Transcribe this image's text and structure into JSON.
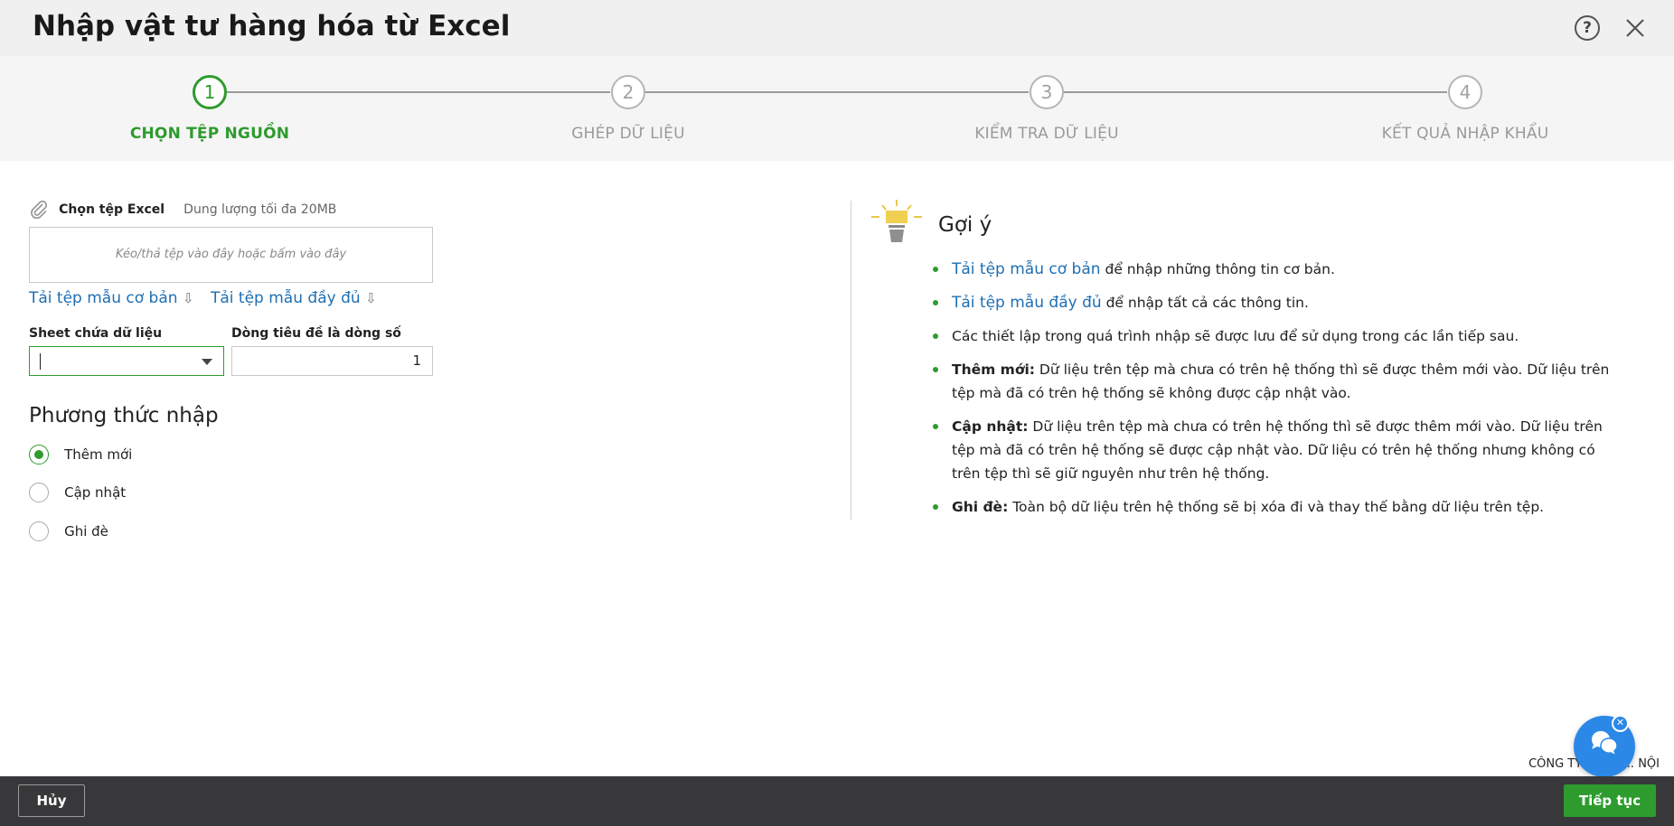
{
  "header": {
    "title": "Nhập vật tư hàng hóa từ Excel",
    "help_label": "?",
    "help_icon": "question-circle-icon",
    "close_icon": "close-icon"
  },
  "steps": [
    {
      "number": "1",
      "label": "CHỌN TỆP NGUỒN",
      "active": true
    },
    {
      "number": "2",
      "label": "GHÉP DỮ LIỆU",
      "active": false
    },
    {
      "number": "3",
      "label": "KIỂM TRA DỮ LIỆU",
      "active": false
    },
    {
      "number": "4",
      "label": "KẾT QUẢ NHẬP KHẨU",
      "active": false
    }
  ],
  "file": {
    "icon": "paperclip-icon",
    "label": "Chọn tệp Excel",
    "size_hint": "Dung lượng tối đa 20MB",
    "dropzone_text": "Kéo/thả tệp vào đây hoặc bấm vào đây",
    "download_basic": "Tải tệp mẫu cơ bản",
    "download_full": "Tải tệp mẫu đầy đủ",
    "download_icon": "arrow-down-icon",
    "download_arrow": "⇩"
  },
  "fields": {
    "sheet_label": "Sheet chứa dữ liệu",
    "sheet_value": "",
    "header_row_label": "Dòng tiêu đề là dòng số",
    "header_row_value": "1"
  },
  "method": {
    "title": "Phương thức nhập",
    "options": [
      {
        "label": "Thêm mới",
        "selected": true
      },
      {
        "label": "Cập nhật",
        "selected": false
      },
      {
        "label": "Ghi đè",
        "selected": false
      }
    ]
  },
  "hints": {
    "icon": "lightbulb-icon",
    "title": "Gợi ý",
    "items": [
      {
        "link": "Tải tệp mẫu cơ bản",
        "text": " để nhập những thông tin cơ bản."
      },
      {
        "link": "Tải tệp mẫu đầy đủ",
        "text": " để nhập tất cả các thông tin."
      },
      {
        "text": "Các thiết lập trong quá trình nhập sẽ được lưu để sử dụng trong các lần tiếp sau."
      },
      {
        "bold": "Thêm mới:",
        "text": " Dữ liệu trên tệp mà chưa có trên hệ thống thì sẽ được thêm mới vào. Dữ liệu trên tệp mà đã có trên hệ thống sẽ không được cập nhật vào."
      },
      {
        "bold": "Cập nhật:",
        "text": " Dữ liệu trên tệp mà chưa có trên hệ thống thì sẽ được thêm mới vào. Dữ liệu trên tệp mà đã có trên hệ thống sẽ được cập nhật vào. Dữ liệu có trên hệ thống nhưng không có trên tệp thì sẽ giữ nguyên như trên hệ thống."
      },
      {
        "bold": "Ghi đè:",
        "text": " Toàn bộ dữ liệu trên hệ thống sẽ bị xóa đi và thay thế bằng dữ liệu trên tệp."
      }
    ]
  },
  "company": "CÔNG TY TNHH ... NỘI",
  "chat": {
    "icon": "chat-bubble-icon",
    "close_label": "✕"
  },
  "footer": {
    "cancel_label": "Hủy",
    "next_label": "Tiếp tục"
  },
  "colors": {
    "accent": "#2e9b2e",
    "link": "#1f6fb2",
    "footer": "#38383a",
    "chat": "#2b88e6"
  }
}
